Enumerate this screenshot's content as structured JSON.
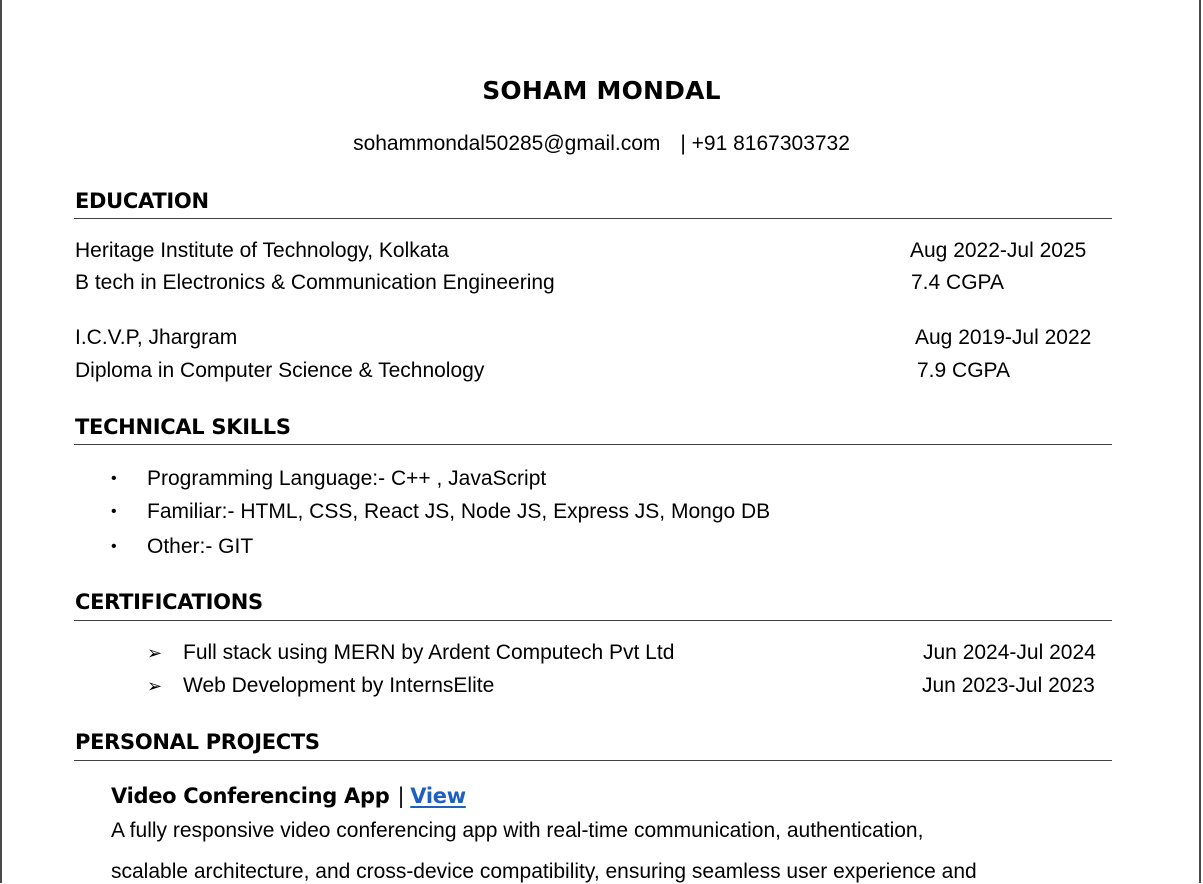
{
  "header": {
    "name": "SOHAM MONDAL",
    "email": "sohammondal50285@gmail.com",
    "phone": "| +91 8167303732"
  },
  "education": {
    "title": "EDUCATION",
    "entries": [
      {
        "institution": "Heritage Institute of Technology, Kolkata",
        "dates": "Aug 2022-Jul 2025",
        "degree": "B tech in Electronics & Communication Engineering",
        "score": "7.4 CGPA"
      },
      {
        "institution": "I.C.V.P, Jhargram",
        "dates": "Aug 2019-Jul 2022",
        "degree": "Diploma in Computer Science & Technology",
        "score": "7.9 CGPA"
      }
    ]
  },
  "skills": {
    "title": "TECHNICAL SKILLS",
    "bullet": "•",
    "items": [
      "Programming Language:- C++ , JavaScript",
      "Familiar:- HTML, CSS, React JS, Node JS, Express JS, Mongo DB",
      "Other:- GIT"
    ]
  },
  "certifications": {
    "title": "CERTIFICATIONS",
    "bullet": "➢",
    "items": [
      {
        "name": "Full stack using MERN by Ardent Computech Pvt Ltd",
        "dates": "Jun 2024-Jul 2024"
      },
      {
        "name": "Web Development by InternsElite",
        "dates": "Jun 2023-Jul 2023"
      }
    ]
  },
  "projects": {
    "title": "PERSONAL PROJECTS",
    "items": [
      {
        "name": "Video Conferencing App",
        "separator": "|",
        "link_label": "View",
        "description_line1": "A fully responsive video conferencing app with real-time communication, authentication,",
        "description_line2": "scalable architecture, and cross-device compatibility, ensuring seamless user experience and"
      }
    ]
  }
}
